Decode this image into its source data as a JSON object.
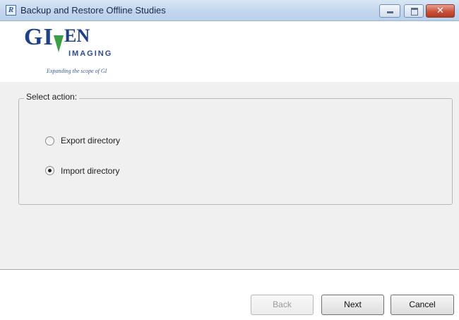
{
  "window": {
    "title": "Backup and Restore Offline Studies",
    "app_icon_glyph": "R"
  },
  "logo": {
    "brand_left": "GI",
    "brand_right": "EN",
    "subtitle": "IMAGING",
    "tagline": "Expanding the scope of GI",
    "colors": {
      "brand": "#1e3f8a",
      "mark": "#3aa043"
    }
  },
  "action_group": {
    "label": "Select action:",
    "options": [
      {
        "label": "Export directory",
        "selected": false
      },
      {
        "label": "Import directory",
        "selected": true
      }
    ]
  },
  "buttons": {
    "back": "Back",
    "next": "Next",
    "cancel": "Cancel"
  },
  "title_controls": {
    "close_glyph": "✕"
  }
}
